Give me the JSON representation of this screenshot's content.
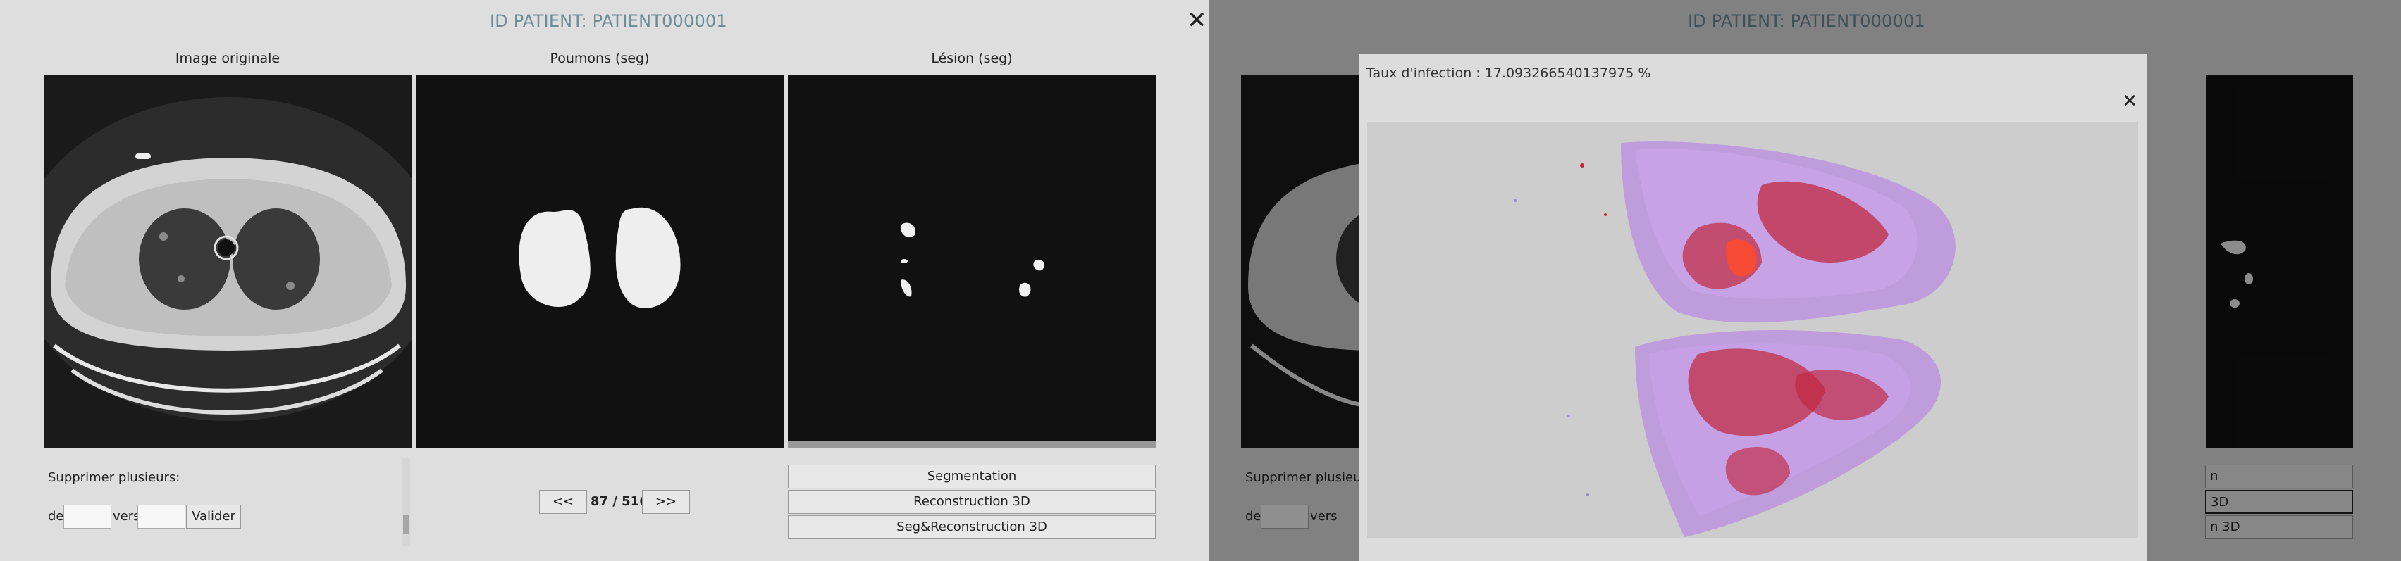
{
  "left": {
    "patient_title": "ID PATIENT: PATIENT000001",
    "close_symbol": "✕",
    "columns": [
      "Image originale",
      "Poumons (seg)",
      "Lésion (seg)"
    ],
    "delete": {
      "label": "Supprimer plusieurs:",
      "from_label": "de",
      "to_label": "vers",
      "validate_label": "Valider"
    },
    "nav": {
      "prev_label": "<<",
      "next_label": ">>",
      "slice_indicator": "87 / 516"
    },
    "actions": [
      "Segmentation",
      "Reconstruction 3D",
      "Seg&Reconstruction 3D"
    ]
  },
  "right": {
    "patient_title": "ID PATIENT: PATIENT000001",
    "modal": {
      "infection_rate": "Taux d'infection : 17.093266540137975 %",
      "close_symbol": "✕"
    },
    "background_texts": {
      "delete_label_partial": "Supprimer plusieur",
      "from_label": "de",
      "to_label": "vers",
      "action_partial_1": "n",
      "action_partial_2": "3D",
      "action_partial_3": "n 3D"
    }
  },
  "colors": {
    "title": "#6b8c99",
    "panel_bg": "#dedede",
    "viewer_bg": "#111111",
    "lung_purple": "#b98be0",
    "lesion_red": "#c0283f"
  }
}
